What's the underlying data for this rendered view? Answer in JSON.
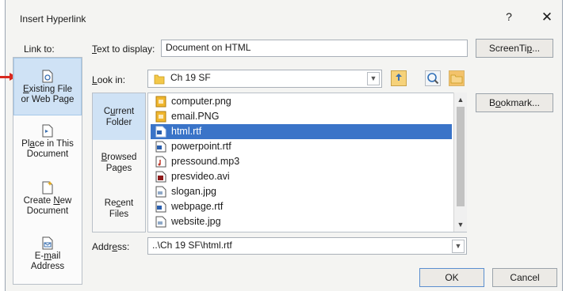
{
  "dialog": {
    "title": "Insert Hyperlink",
    "help": "?",
    "close": "✕"
  },
  "link_to": {
    "label": "Link to:",
    "items": [
      {
        "line1_pre": "",
        "line1_ul": "E",
        "line1_post": "xisting File",
        "line2": "or Web Page",
        "icon": "existing-file-icon"
      },
      {
        "line1_pre": "Pl",
        "line1_ul": "a",
        "line1_post": "ce in This",
        "line2": "Document",
        "icon": "place-in-document-icon"
      },
      {
        "line1_pre": "Create ",
        "line1_ul": "N",
        "line1_post": "ew",
        "line2": "Document",
        "icon": "create-new-document-icon"
      },
      {
        "line1_pre": "E-",
        "line1_ul": "m",
        "line1_post": "ail",
        "line2": "Address",
        "icon": "email-address-icon"
      }
    ]
  },
  "text_to_display": {
    "label_ul": "T",
    "label_rest": "ext to display:",
    "value": "Document on HTML"
  },
  "screentip_button": {
    "pre": "ScreenTi",
    "ul": "p",
    "post": "..."
  },
  "look_in": {
    "label_pre": "",
    "label_ul": "L",
    "label_rest": "ook in:",
    "value": "Ch 19 SF"
  },
  "bookmark_button": {
    "pre": "B",
    "ul": "o",
    "post": "okmark..."
  },
  "subnav": [
    {
      "line1_pre": "C",
      "line1_ul": "u",
      "line1_post": "rrent",
      "line2": "Folder"
    },
    {
      "line1_pre": "",
      "line1_ul": "B",
      "line1_post": "rowsed",
      "line2": "Pages"
    },
    {
      "line1_pre": "Re",
      "line1_ul": "c",
      "line1_post": "ent",
      "line2": "Files"
    }
  ],
  "files": [
    {
      "name": "computer.png",
      "icon": "png-file-icon"
    },
    {
      "name": "email.PNG",
      "icon": "png-file-icon"
    },
    {
      "name": "html.rtf",
      "icon": "rtf-file-icon"
    },
    {
      "name": "powerpoint.rtf",
      "icon": "rtf-file-icon"
    },
    {
      "name": "pressound.mp3",
      "icon": "audio-file-icon"
    },
    {
      "name": "presvideo.avi",
      "icon": "video-file-icon"
    },
    {
      "name": "slogan.jpg",
      "icon": "image-file-icon"
    },
    {
      "name": "webpage.rtf",
      "icon": "rtf-file-icon"
    },
    {
      "name": "website.jpg",
      "icon": "image-file-icon"
    }
  ],
  "address": {
    "label_pre": "Addr",
    "label_ul": "e",
    "label_rest": "ss:",
    "value": "..\\Ch 19 SF\\html.rtf"
  },
  "ok_label": "OK",
  "cancel_label": "Cancel",
  "colors": {
    "selection": "#3a74c8",
    "active_nav": "#cfe2f5",
    "arrow": "#d8281f"
  }
}
